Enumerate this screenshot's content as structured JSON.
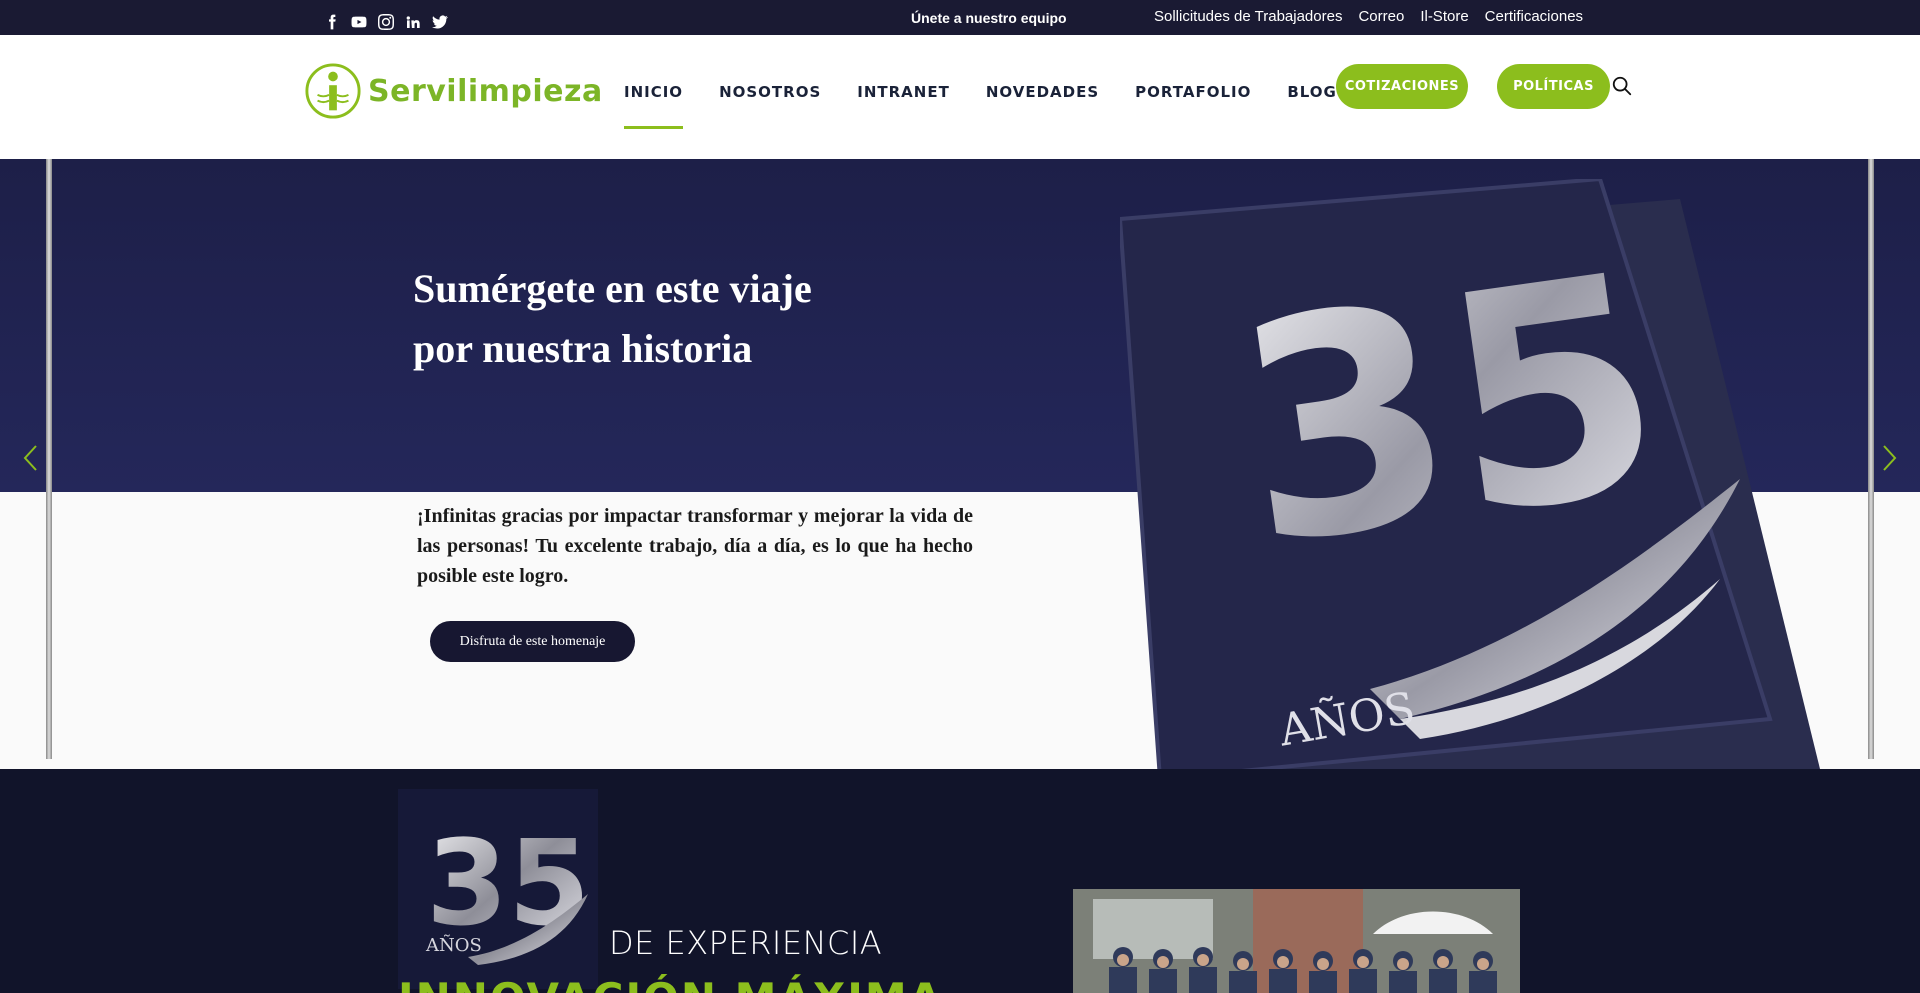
{
  "topbar": {
    "social_icons": [
      "facebook-icon",
      "youtube-icon",
      "instagram-icon",
      "linkedin-icon",
      "twitter-icon"
    ],
    "join_label": "Únete a nuestro equipo",
    "links": [
      "Sollicitudes de Trabajadores",
      "Correo",
      "Il-Store",
      "Certificaciones"
    ]
  },
  "header": {
    "logo_text": "Servilimpieza",
    "nav": [
      "INICIO",
      "NOSOTROS",
      "INTRANET",
      "NOVEDADES",
      "PORTAFOLIO",
      "BLOG"
    ],
    "active_nav": "INICIO",
    "cotizaciones_label": "COTIZACIONES",
    "politicas_label": "POLÍTICAS"
  },
  "hero": {
    "title_line1": "Sumérgete en este viaje",
    "title_line2": "por nuestra historia",
    "body": "¡Infinitas gracias por impactar transformar y mejorar la vida de las personas! Tu excelente trabajo, día a día, es lo que ha hecho posible este logro.",
    "cta_label": "Disfruta de este homenaje",
    "book_number": "35",
    "book_years": "AÑOS"
  },
  "experience": {
    "badge_number": "35",
    "badge_years": "AÑOS",
    "label": "DE EXPERIENCIA",
    "heading_partial": "INNOVACIÓN MÁXIMA"
  },
  "colors": {
    "brand_green": "#8cbe1d",
    "navy": "#1a1a33",
    "dark_section": "#11142a"
  }
}
